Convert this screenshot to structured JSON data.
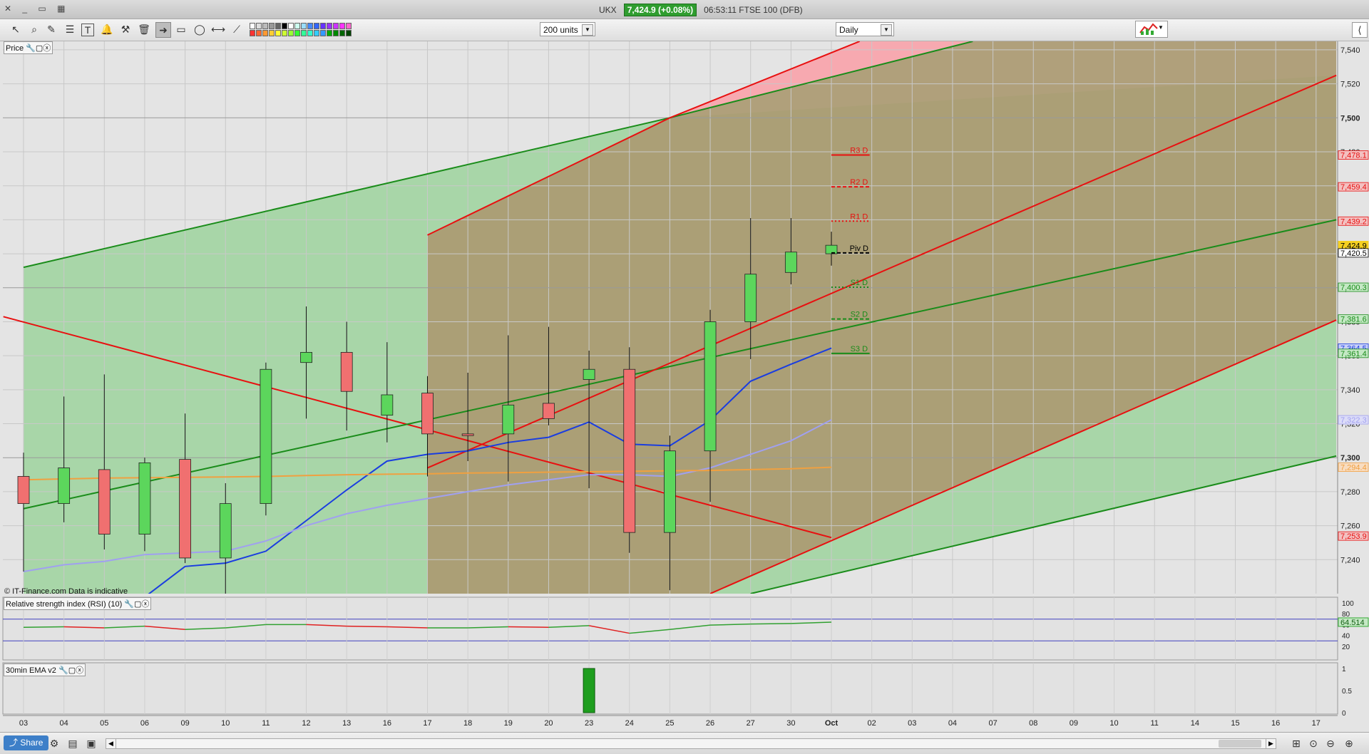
{
  "titlebar": {
    "symbol": "UKX",
    "price_badge": "7,424.9 (+0.08%)",
    "time_and_name": "06:53:11 FTSE 100 (DFB)"
  },
  "toolbar": {
    "units_select": "200 units",
    "period_select": "Daily"
  },
  "panels": {
    "price_label": "Price",
    "rsi_label": "Relative strength index (RSI) (10)",
    "ema_label": "30min EMA v2",
    "watermark": "© IT-Finance.com  Data is indicative"
  },
  "bottombar": {
    "share_label": "Share"
  },
  "colors": {
    "up_candle": "#5cd65c",
    "down_candle": "#f07070",
    "red_line": "#e81010",
    "green_line": "#1a8c1a",
    "ma_blue": "#1a3de0",
    "ma_lilac": "#a0a0f0",
    "ma_orange": "#f0a040",
    "channel_green": "#9ed39e",
    "channel_brown": "#ab9a72",
    "channel_pink": "#f7a9b0",
    "background": "#e4e4e4"
  },
  "icons": [
    "pointer-icon",
    "zoom-icon",
    "draw-icon",
    "ratio-icon",
    "text-icon",
    "alert-icon",
    "hammer-icon",
    "trash-icon",
    "arrow-icon",
    "rectangle-icon",
    "ellipse-icon",
    "line-icon",
    "trendline-icon"
  ],
  "chart_data": {
    "type": "candlestick",
    "y_axis": {
      "min": 7220,
      "max": 7545,
      "ticks": [
        "7,540",
        "7,520",
        "7,500",
        "7,480",
        "7,460",
        "7,440",
        "7,420",
        "7,400",
        "7,380",
        "7,360",
        "7,340",
        "7,320",
        "7,300",
        "7,280",
        "7,260",
        "7,240"
      ]
    },
    "x_labels": [
      "03",
      "04",
      "05",
      "06",
      "09",
      "10",
      "11",
      "12",
      "13",
      "16",
      "17",
      "18",
      "19",
      "20",
      "23",
      "24",
      "25",
      "26",
      "27",
      "30",
      "Oct",
      "02",
      "03",
      "04",
      "07",
      "08",
      "09",
      "10",
      "11",
      "14",
      "15",
      "16",
      "17"
    ],
    "candles": [
      {
        "d": "03",
        "o": 7289,
        "h": 7303,
        "l": 7233,
        "c": 7273
      },
      {
        "d": "04",
        "o": 7273,
        "h": 7336,
        "l": 7262,
        "c": 7294
      },
      {
        "d": "05",
        "o": 7293,
        "h": 7349,
        "l": 7246,
        "c": 7255
      },
      {
        "d": "06",
        "o": 7255,
        "h": 7300,
        "l": 7245,
        "c": 7297
      },
      {
        "d": "09",
        "o": 7299,
        "h": 7326,
        "l": 7238,
        "c": 7241
      },
      {
        "d": "10",
        "o": 7241,
        "h": 7285,
        "l": 7218,
        "c": 7273
      },
      {
        "d": "11",
        "o": 7273,
        "h": 7356,
        "l": 7266,
        "c": 7352
      },
      {
        "d": "12",
        "o": 7356,
        "h": 7389,
        "l": 7323,
        "c": 7362
      },
      {
        "d": "13",
        "o": 7362,
        "h": 7380,
        "l": 7316,
        "c": 7339
      },
      {
        "d": "16",
        "o": 7325,
        "h": 7368,
        "l": 7309,
        "c": 7337
      },
      {
        "d": "17",
        "o": 7338,
        "h": 7348,
        "l": 7289,
        "c": 7314
      },
      {
        "d": "18",
        "o": 7314,
        "h": 7350,
        "l": 7298,
        "c": 7313
      },
      {
        "d": "19",
        "o": 7314,
        "h": 7372,
        "l": 7286,
        "c": 7331
      },
      {
        "d": "20",
        "o": 7332,
        "h": 7377,
        "l": 7319,
        "c": 7323
      },
      {
        "d": "23",
        "o": 7346,
        "h": 7363,
        "l": 7282,
        "c": 7352
      },
      {
        "d": "24",
        "o": 7352,
        "h": 7365,
        "l": 7244,
        "c": 7256
      },
      {
        "d": "25",
        "o": 7256,
        "h": 7313,
        "l": 7222,
        "c": 7304
      },
      {
        "d": "26",
        "o": 7304,
        "h": 7387,
        "l": 7274,
        "c": 7380
      },
      {
        "d": "27",
        "o": 7380,
        "h": 7441,
        "l": 7358,
        "c": 7408
      },
      {
        "d": "30",
        "o": 7409,
        "h": 7441,
        "l": 7402,
        "c": 7421
      },
      {
        "d": "Oct",
        "o": 7420,
        "h": 7433,
        "l": 7413,
        "c": 7425
      }
    ],
    "moving_averages": [
      {
        "color": "blue",
        "values": [
          null,
          null,
          7214,
          7218,
          7236,
          7238,
          7245,
          7263,
          7281,
          7298,
          7302,
          7304,
          7309,
          7312,
          7321,
          7308,
          7307,
          7322,
          7345,
          7355,
          7364.5
        ]
      },
      {
        "color": "lilac",
        "values": [
          7233,
          7237,
          7239,
          7243,
          7244,
          7245,
          7251,
          7260,
          7267,
          7272,
          7276,
          7280,
          7284,
          7287,
          7290,
          7290,
          7289,
          7294,
          7302,
          7310,
          7322.3
        ]
      },
      {
        "color": "orange",
        "values": [
          7287,
          7287.5,
          7288,
          7288.2,
          7288.5,
          7288.7,
          7289,
          7289.5,
          7290,
          7290.3,
          7290.5,
          7291,
          7291.2,
          7291.5,
          7291.7,
          7292,
          7292.3,
          7292.5,
          7293,
          7293.5,
          7294.4
        ]
      }
    ],
    "pivots": [
      {
        "label": "R3 D",
        "value": 7478.1,
        "color": "red",
        "style": "solid"
      },
      {
        "label": "R2 D",
        "value": 7459.4,
        "color": "red",
        "style": "dashed"
      },
      {
        "label": "R1 D",
        "value": 7439.2,
        "color": "red",
        "style": "dotted"
      },
      {
        "label": "Piv D",
        "value": 7420.5,
        "color": "black",
        "style": "dashed"
      },
      {
        "label": "S1 D",
        "value": 7400.3,
        "color": "green",
        "style": "dotted"
      },
      {
        "label": "S2 D",
        "value": 7381.6,
        "color": "green",
        "style": "dashed"
      },
      {
        "label": "S3 D",
        "value": 7361.4,
        "color": "green",
        "style": "solid"
      }
    ],
    "price_flags": [
      {
        "value": 7478.1,
        "label": "7,478.1",
        "color": "red"
      },
      {
        "value": 7459.4,
        "label": "7,459.4",
        "color": "red"
      },
      {
        "value": 7439.2,
        "label": "7,439.2",
        "color": "red"
      },
      {
        "value": 7424.9,
        "label": "7,424.9",
        "color": "yellow"
      },
      {
        "value": 7420.5,
        "label": "7,420.5",
        "color": "black"
      },
      {
        "value": 7400.3,
        "label": "7,400.3",
        "color": "green"
      },
      {
        "value": 7381.6,
        "label": "7,381.6",
        "color": "green"
      },
      {
        "value": 7364.5,
        "label": "7,364.5",
        "color": "blue"
      },
      {
        "value": 7361.4,
        "label": "7,361.4",
        "color": "green"
      },
      {
        "value": 7322.3,
        "label": "7,322.3",
        "color": "lilac"
      },
      {
        "value": 7294.4,
        "label": "7,294.4",
        "color": "orange"
      },
      {
        "value": 7253.9,
        "label": "7,253.9",
        "color": "red"
      }
    ],
    "trendlines": [
      {
        "color": "red",
        "i0": -0.5,
        "v0": 7383,
        "i1": 20,
        "v1": 7253
      },
      {
        "color": "green",
        "i0": 0,
        "v0": 7412,
        "i1": 16,
        "v1": 7500
      },
      {
        "color": "green",
        "i0": 16,
        "v0": 7500,
        "i1": 23.5,
        "v1": 7545
      },
      {
        "color": "green",
        "i0": 0,
        "v0": 7270,
        "i1": 32.5,
        "v1": 7440
      },
      {
        "color": "red",
        "i0": 10,
        "v0": 7294,
        "i1": 32.5,
        "v1": 7525
      },
      {
        "color": "red",
        "i0": 10,
        "v0": 7431,
        "i1": 16,
        "v1": 7500
      },
      {
        "color": "red",
        "i0": 16,
        "v0": 7500,
        "i1": 20.7,
        "v1": 7545
      },
      {
        "color": "red",
        "i0": 17,
        "v0": 7220,
        "i1": 32.5,
        "v1": 7381
      },
      {
        "color": "green",
        "i0": 18,
        "v0": 7220,
        "i1": 32.5,
        "v1": 7301
      }
    ],
    "rsi": {
      "ticks": [
        "100",
        "80",
        "60",
        "40",
        "20"
      ],
      "current": "64.514",
      "values": [
        55,
        56,
        54,
        57,
        51,
        54,
        60,
        60,
        57,
        56,
        54,
        54,
        56,
        55,
        58,
        44,
        51,
        59,
        61,
        62,
        64.5
      ]
    },
    "ema_panel": {
      "ticks": [
        "1",
        "0.5",
        "0"
      ],
      "bars": [
        {
          "d": "23",
          "value": 1
        }
      ]
    }
  }
}
